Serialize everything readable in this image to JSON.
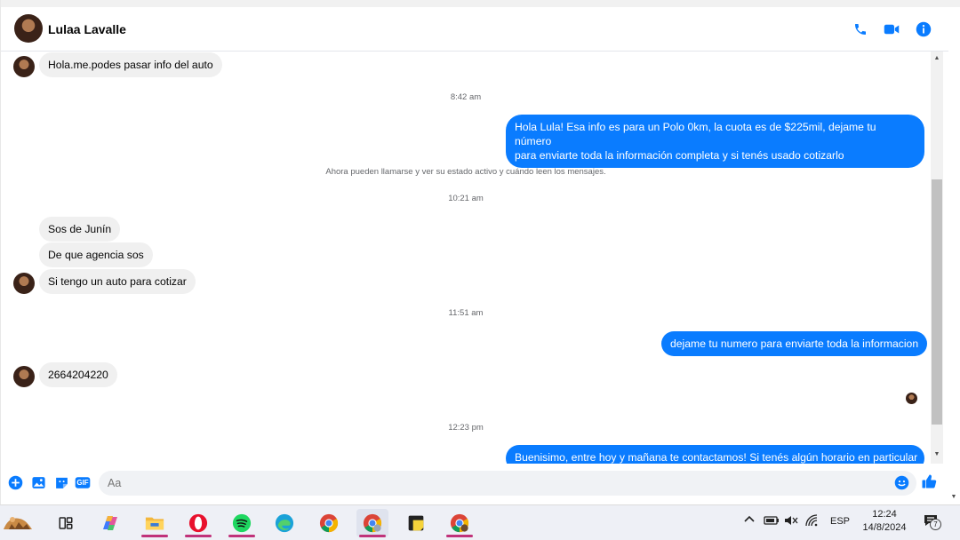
{
  "header": {
    "contact_name": "Lulaa Lavalle",
    "icons": [
      "phone-icon",
      "video-icon",
      "info-icon"
    ],
    "accent_color": "#0a7cff"
  },
  "messages": {
    "m1": "Hola.me.podes pasar info del auto",
    "ts1": "8:42 am",
    "m2_line1": "Hola Lula! Esa info es para un Polo 0km, la cuota es de $225mil, dejame tu número",
    "m2_line2": "para enviarte toda la información completa y si tenés usado cotizarlo",
    "system": "Ahora pueden llamarse y ver su estado activo y cuándo leen los mensajes.",
    "ts2": "10:21 am",
    "m3": "Sos de Junín",
    "m4": "De que agencia sos",
    "m5": "Si tengo un auto para cotizar",
    "ts3": "11:51 am",
    "m6": "dejame tu numero para enviarte toda la informacion",
    "m7": "2664204220",
    "ts4": "12:23 pm",
    "m8_partial": "Buenisimo, entre hoy y mañana te contactamos! Si tenés algún horario en particular"
  },
  "composer": {
    "placeholder": "Aa",
    "icons": [
      "plus-icon",
      "image-icon",
      "sticker-icon",
      "gif-icon",
      "emoji-icon",
      "like-icon"
    ],
    "gif_label": "GIF"
  },
  "taskbar": {
    "apps": [
      "widgets-icon",
      "task-view-icon",
      "copilot-icon",
      "file-explorer-icon",
      "opera-icon",
      "spotify-icon",
      "edge-icon",
      "chrome-icon",
      "chrome-profile-icon",
      "sticky-notes-icon",
      "chrome-profile2-icon"
    ],
    "language": "ESP",
    "time": "12:24",
    "date": "14/8/2024",
    "notification_count": "7"
  }
}
